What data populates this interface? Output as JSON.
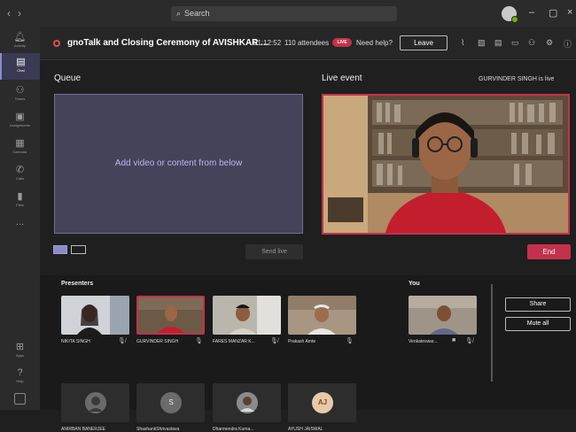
{
  "titlebar": {
    "search_placeholder": "Search",
    "nav_back": "‹",
    "nav_forward": "›",
    "minimize": "–",
    "maximize": "▢",
    "close": "×"
  },
  "rail": {
    "items": [
      {
        "label": "Activity",
        "icon": "bell-icon"
      },
      {
        "label": "Chat",
        "icon": "chat-icon"
      },
      {
        "label": "Teams",
        "icon": "teams-icon"
      },
      {
        "label": "Assignments",
        "icon": "assignments-icon"
      },
      {
        "label": "Calendar",
        "icon": "calendar-icon"
      },
      {
        "label": "Calls",
        "icon": "calls-icon"
      },
      {
        "label": "Files",
        "icon": "files-icon"
      },
      {
        "label": "...",
        "icon": "more-icon"
      },
      {
        "label": "Apps",
        "icon": "apps-icon"
      },
      {
        "label": "Help",
        "icon": "help-icon"
      }
    ]
  },
  "header": {
    "title": "gnoTalk and Closing Ceremony of AVISHKAR ...",
    "elapsed": "01:12:52",
    "attendees": "110 attendees",
    "live": "LIVE",
    "help": "Need help?",
    "leave": "Leave"
  },
  "queue": {
    "label": "Queue",
    "placeholder": "Add video or content from below",
    "send_live": "Send live"
  },
  "live": {
    "label": "Live event",
    "status": "GURVINDER SINGH is live",
    "end": "End"
  },
  "presenters": {
    "label": "Presenters",
    "you_label": "You",
    "row1": [
      {
        "name": "NIKITA SINGH",
        "mic": "muted"
      },
      {
        "name": "GURVINDER SINGH",
        "mic": "on"
      },
      {
        "name": "FARES MANZAR K...",
        "mic": "muted"
      },
      {
        "name": "Prakash Amte",
        "mic": "on"
      }
    ],
    "row2": [
      {
        "name": "ANIRBAN BANERJEE",
        "initials": ""
      },
      {
        "name": "ShashankShrivastava",
        "initials": "S"
      },
      {
        "name": "Dharmendra Kuma...",
        "initials": ""
      },
      {
        "name": "AYUSH JAISWAL",
        "initials": "AJ"
      }
    ],
    "you": {
      "name": "Venkateswar..."
    },
    "share": "Share",
    "mute_all": "Mute all"
  }
}
